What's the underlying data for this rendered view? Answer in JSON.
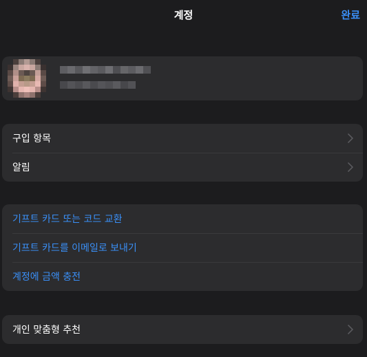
{
  "nav": {
    "title": "계정",
    "done_label": "완료"
  },
  "colors": {
    "background": "#1c1c1e",
    "group": "#2c2c2e",
    "separator": "#3a3a3c",
    "accent": "#3a8ff7",
    "text": "#ffffff",
    "chevron": "#5a5a5e"
  },
  "group1": {
    "items": [
      {
        "label": "구입 항목",
        "icon": "chevron-right-icon"
      },
      {
        "label": "알림",
        "icon": "chevron-right-icon"
      }
    ]
  },
  "group2": {
    "items": [
      {
        "label": "기프트 카드 또는 코드 교환"
      },
      {
        "label": "기프트 카드를 이메일로 보내기"
      },
      {
        "label": "계정에 금액 충전"
      }
    ]
  },
  "group3": {
    "items": [
      {
        "label": "개인 맞춤형 추천",
        "icon": "chevron-right-icon"
      }
    ]
  }
}
